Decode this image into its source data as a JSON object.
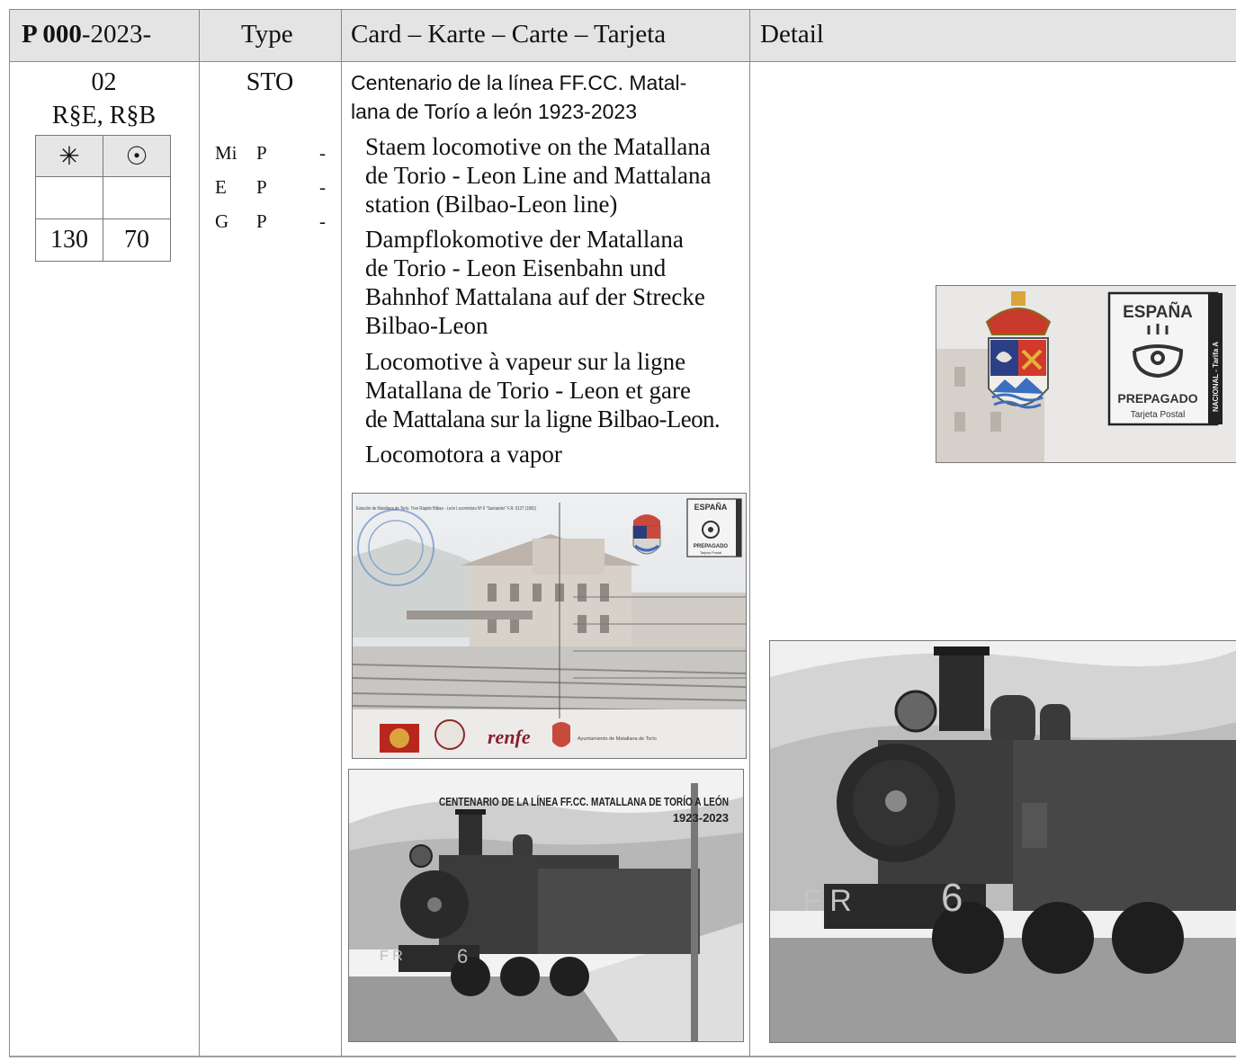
{
  "header": {
    "code_bold": "P 000",
    "code_rest": "-2023-",
    "type": "Type",
    "card": "Card – Karte – Carte – Tarjeta",
    "detail": "Detail"
  },
  "entry": {
    "number": "02",
    "printing": "R§E, R§B",
    "value_table": {
      "headers": [
        "✳",
        "☉"
      ],
      "blank_row": [
        "",
        ""
      ],
      "values": [
        "130",
        "70"
      ]
    },
    "type": "STO",
    "catalogs": [
      {
        "name": "Mi",
        "code": "P",
        "dash": "-"
      },
      {
        "name": "E",
        "code": "P",
        "dash": "-"
      },
      {
        "name": "G",
        "code": "P",
        "dash": "-"
      }
    ],
    "title_line1": "Centenario de la línea FF.CC. Matal-",
    "title_line2": "lana de Torío a león 1923-2023",
    "descriptions": {
      "en": [
        "Staem locomotive on the Matallana",
        "de Torio - Leon Line and Mattalana",
        "station (Bilbao-Leon line)"
      ],
      "de": [
        "Dampflokomotive der Matallana",
        "de Torio - Leon Eisenbahn und",
        "Bahnhof Mattalana auf der Strecke",
        "Bilbao-Leon"
      ],
      "fr": [
        "Locomotive à vapeur sur la ligne",
        "Matallana de Torio - Leon et gare",
        "de Mattalana sur la ligne Bilbao-Leon."
      ],
      "es": [
        "Locomotora a vapor"
      ]
    }
  },
  "images": {
    "card_front": {
      "caption": "Estación de Matallana de Torío. Tren Rápido Bilbao - León Locomotora Nº 6 \"Santander\" F.R. 013T (1892)",
      "stamp_country": "ESPAÑA",
      "stamp_text": "PREPAGADO",
      "stamp_sub": "Tarjeta Postal",
      "stamp_side": "NACIONAL - Tarifa A",
      "footer_brand": "renfe",
      "footer_text": "Ayuntamiento de Matallana de Torío"
    },
    "card_back": {
      "headline1": "CENTENARIO DE LA LÍNEA FF.CC. MATALLANA DE TORÍO A LEÓN",
      "headline2": "1923-2023",
      "loco_number": "6",
      "loco_letters": "F R"
    },
    "stamp_detail": {
      "country": "ESPAÑA",
      "prepaid": "PREPAGADO",
      "sub": "Tarjeta Postal",
      "side": "NACIONAL - Tarifa A"
    },
    "loco_detail": {
      "loco_number": "6",
      "loco_letters": "F R"
    }
  }
}
